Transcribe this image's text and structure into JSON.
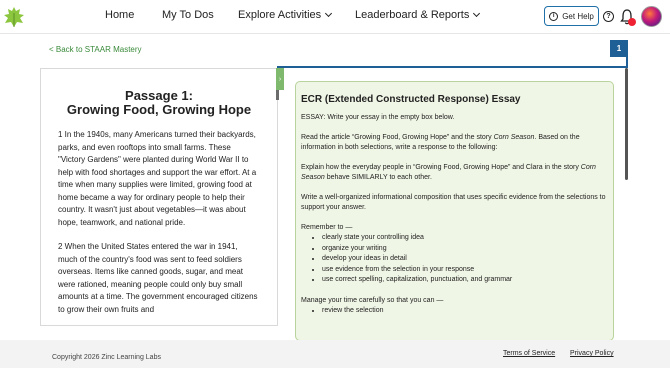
{
  "nav": {
    "home": "Home",
    "todos": "My To Dos",
    "explore": "Explore Activities",
    "leaderboard": "Leaderboard & Reports",
    "help": "Get Help"
  },
  "back_link": "< Back to STAAR Mastery",
  "page_tab": "1",
  "passage": {
    "title_line1": "Passage 1:",
    "title_line2": "Growing Food, Growing Hope",
    "p1": "1     In the 1940s, many Americans turned their backyards, parks, and even rooftops into small farms. These \"Victory Gardens\" were planted during World War II to help with food shortages and support the war effort. At a time when many supplies were limited, growing food at home became a way for ordinary people to help their country. It wasn't just about vegetables—it was about hope, teamwork, and national pride.",
    "p2": "2     When the United States entered the war in 1941, much of the country's food was sent to feed soldiers overseas. Items like canned goods, sugar, and meat were rationed, meaning people could only buy small amounts at a time. The government encouraged citizens to grow their own fruits and"
  },
  "ecr": {
    "title": "ECR (Extended Constructed Response) Essay",
    "instr": "ESSAY: Write your essay in the empty box below.",
    "read_a": "Read the article “Growing Food, Growing Hope” and the story ",
    "read_em": "Corn Season",
    "read_b": ". Based on the information in both selections, write a response to the following:",
    "explain_a": "Explain how the everyday people in “Growing Food, Growing Hope” and Clara in the story ",
    "explain_em": "Corn Season",
    "explain_b": " behave SIMILARLY to each other.",
    "write": "Write a well-organized informational composition that uses specific evidence from the selections to support your answer.",
    "remember": "Remember to —",
    "remember_items": [
      "clearly state your controlling idea",
      "organize your writing",
      "develop your ideas in detail",
      "use evidence from the selection in your response",
      "use correct spelling, capitalization, punctuation, and grammar"
    ],
    "manage": "Manage your time carefully so that you can —",
    "manage_items": [
      "review the selection"
    ]
  },
  "footer": {
    "copyright": "Copyright 2026 Zinc Learning Labs",
    "terms": "Terms of Service",
    "privacy": "Privacy Policy"
  },
  "colors": {
    "accent": "#1e5f95",
    "green": "#3a8a3a",
    "panel": "#f0f6e6"
  }
}
